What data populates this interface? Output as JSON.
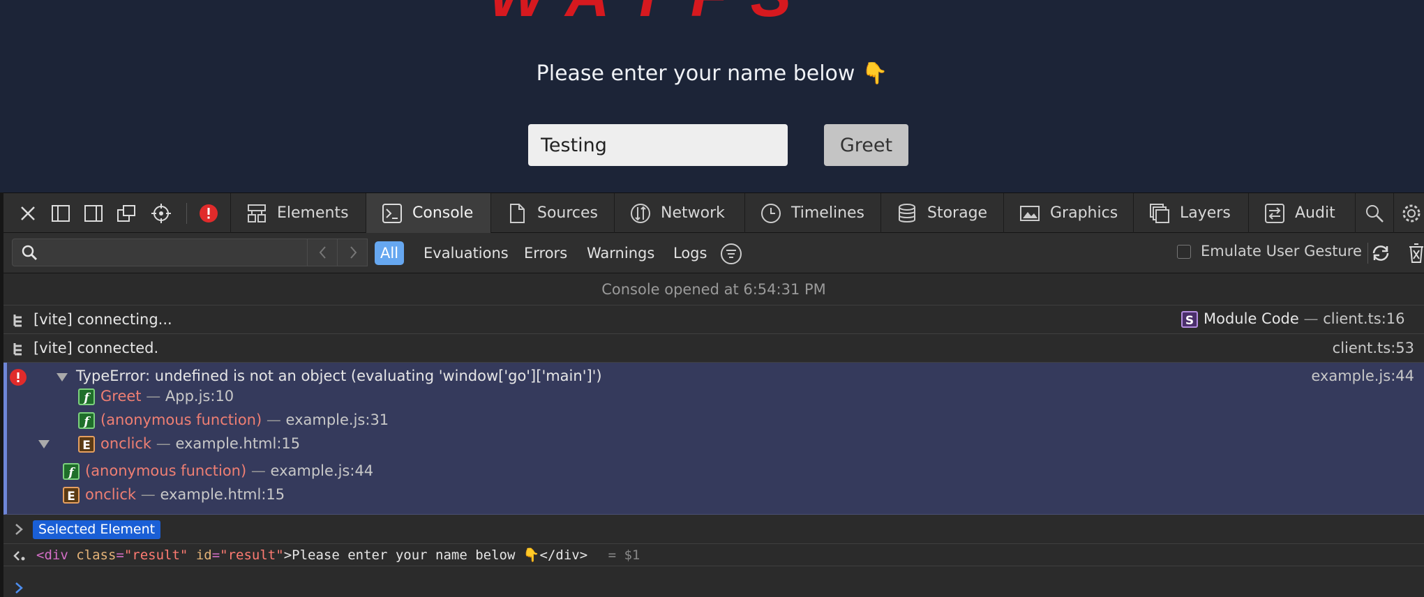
{
  "page": {
    "hero_text": "WAYFS",
    "prompt_text": "Please enter your name below",
    "prompt_emoji": "👇",
    "input_value": "Testing",
    "greet_label": "Greet"
  },
  "devtools": {
    "tabs": [
      {
        "label": "Elements"
      },
      {
        "label": "Console"
      },
      {
        "label": "Sources"
      },
      {
        "label": "Network"
      },
      {
        "label": "Timelines"
      },
      {
        "label": "Storage"
      },
      {
        "label": "Graphics"
      },
      {
        "label": "Layers"
      },
      {
        "label": "Audit"
      }
    ],
    "selected_tab": "Console",
    "filters": [
      {
        "label": "All"
      },
      {
        "label": "Evaluations"
      },
      {
        "label": "Errors"
      },
      {
        "label": "Warnings"
      },
      {
        "label": "Logs"
      }
    ],
    "emulate_label": "Emulate User Gesture",
    "colors": {
      "accent": "#66a7f0",
      "error": "#e02b2b",
      "function_name": "#ef7f73",
      "selected_badge": "#1a5fd6"
    }
  },
  "console": {
    "opened": "Console opened at 6:54:31 PM",
    "messages": [
      {
        "text": "[vite] connecting...",
        "source_badge": "S",
        "source_label": "Module Code",
        "location": "client.ts:16"
      },
      {
        "text": "[vite] connected.",
        "location": "client.ts:53"
      }
    ],
    "error": {
      "text": "TypeError: undefined is not an object (evaluating 'window['go']['main']')",
      "location": "example.js:44",
      "frames": [
        {
          "badge": "f",
          "name": "Greet",
          "loc": "App.js:10"
        },
        {
          "badge": "f",
          "name": "(anonymous function)",
          "loc": "example.js:31"
        },
        {
          "badge": "E",
          "name": "onclick",
          "loc": "example.html:15"
        },
        {
          "badge": "f",
          "name": "(anonymous function)",
          "loc": "example.js:44"
        },
        {
          "badge": "E",
          "name": "onclick",
          "loc": "example.html:15"
        }
      ]
    },
    "selected_element_label": "Selected Element",
    "result": {
      "open": "<div ",
      "attr1": "class",
      "val1": "\"result\"",
      "attr2": "id",
      "val2": "\"result\"",
      "content": ">Please enter your name below 👇</div>",
      "ref": "= $1"
    }
  }
}
